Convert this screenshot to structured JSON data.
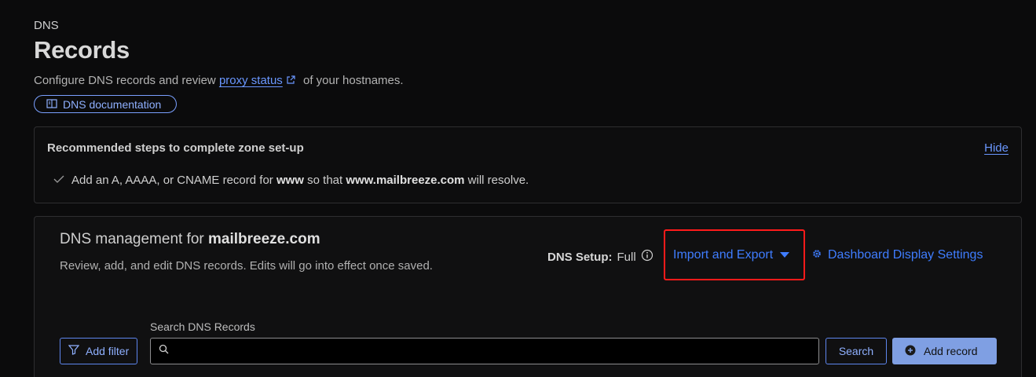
{
  "header": {
    "breadcrumb": "DNS",
    "title": "Records",
    "subtitle_before": "Configure DNS records and review ",
    "subtitle_link": "proxy status",
    "subtitle_after": " of your hostnames.",
    "doc_button": "DNS documentation"
  },
  "setup_card": {
    "title": "Recommended steps to complete zone set-up",
    "hide_label": "Hide",
    "step": {
      "prefix": "Add an A, AAAA, or CNAME record for ",
      "bold1": "www",
      "middle": " so that ",
      "bold2": "www.mailbreeze.com",
      "suffix": " will resolve."
    }
  },
  "management": {
    "title_prefix": "DNS management for ",
    "domain": "mailbreeze.com",
    "description": "Review, add, and edit DNS records. Edits will go into effect once saved.",
    "dns_setup_label": "DNS Setup:",
    "dns_setup_value": "Full",
    "import_export_label": "Import and Export",
    "dashboard_settings_label": "Dashboard Display Settings",
    "add_filter_label": "Add filter",
    "search_label": "Search DNS Records",
    "search_value": "",
    "search_button": "Search",
    "add_record_button": "Add record"
  },
  "colors": {
    "accent": "#3f7dff",
    "link": "#6a97ff",
    "highlight_box": "#ff1a1a",
    "primary_button": "#7f9fe3"
  }
}
